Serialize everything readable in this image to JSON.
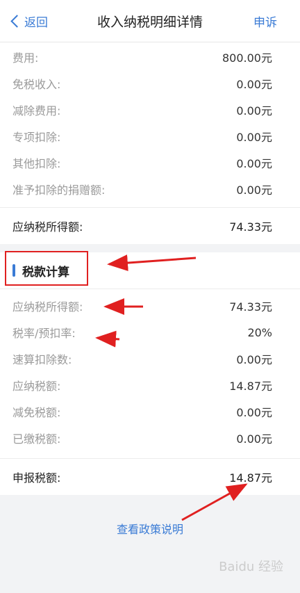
{
  "nav": {
    "back_label": "返回",
    "title": "收入纳税明细详情",
    "action_label": "申诉"
  },
  "deductions": [
    {
      "label": "费用:",
      "value": "800.00元"
    },
    {
      "label": "免税收入:",
      "value": "0.00元"
    },
    {
      "label": "减除费用:",
      "value": "0.00元"
    },
    {
      "label": "专项扣除:",
      "value": "0.00元"
    },
    {
      "label": "其他扣除:",
      "value": "0.00元"
    },
    {
      "label": "准予扣除的捐赠额:",
      "value": "0.00元"
    }
  ],
  "taxable_income": {
    "label": "应纳税所得额:",
    "value": "74.33元"
  },
  "tax_calc": {
    "title": "税款计算",
    "rows": [
      {
        "label": "应纳税所得额:",
        "value": "74.33元"
      },
      {
        "label": "税率/预扣率:",
        "value": "20%"
      },
      {
        "label": "速算扣除数:",
        "value": "0.00元"
      },
      {
        "label": "应纳税额:",
        "value": "14.87元"
      },
      {
        "label": "减免税额:",
        "value": "0.00元"
      },
      {
        "label": "已缴税额:",
        "value": "0.00元"
      }
    ],
    "declared": {
      "label": "申报税额:",
      "value": "14.87元"
    }
  },
  "policy_link": "查看政策说明",
  "watermark": "Baidu 经验",
  "colors": {
    "accent": "#3a7bd5",
    "annotation": "#e02020",
    "background": "#f2f3f5"
  }
}
